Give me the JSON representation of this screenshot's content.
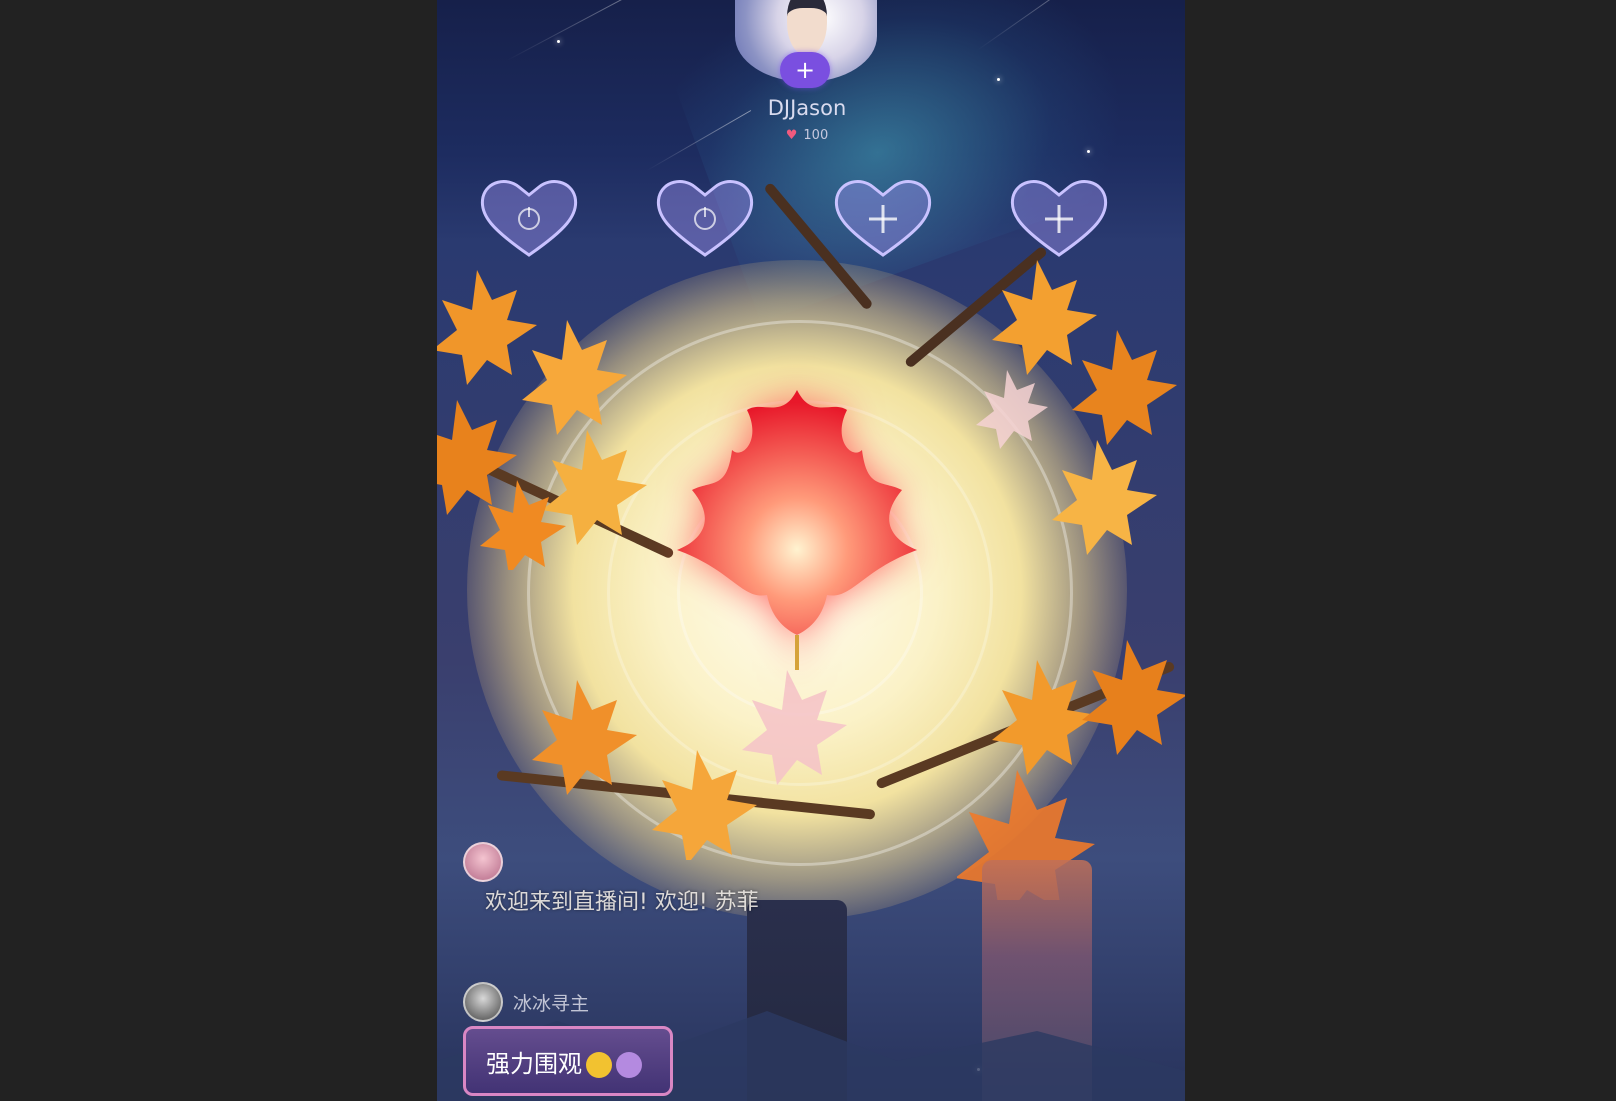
{
  "host": {
    "name": "DJJason",
    "score": "100",
    "follow_icon": "+"
  },
  "seats": [
    {
      "label": "",
      "icon": "heart-seat-power-icon"
    },
    {
      "label": "",
      "icon": "heart-seat-power-icon"
    },
    {
      "label": "",
      "icon": "heart-seat-add-icon"
    },
    {
      "label": "",
      "icon": "heart-seat-add-icon"
    }
  ],
  "chat": {
    "welcome": "欢迎来到直播间! 欢迎! 苏菲",
    "user2_name": "冰冰寻主",
    "bubble_text": "强力围观"
  },
  "colors": {
    "background": "#222222",
    "accent": "#7a4fe0",
    "bubble_border": "#d987c4"
  }
}
